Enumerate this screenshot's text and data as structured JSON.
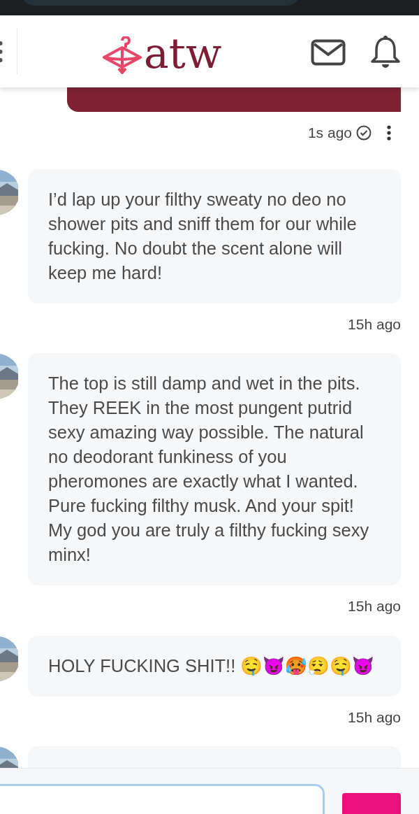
{
  "header": {
    "logo_text": "atw"
  },
  "sent_message": {
    "time": "1s ago",
    "read": true
  },
  "messages": [
    {
      "text": "I’d lap up your filthy sweaty no deo no shower pits and sniff them for our while fucking. No doubt the scent alone will keep me hard!",
      "time": "15h ago"
    },
    {
      "text": "The top is still damp and wet in the pits. They REEK in the most pungent putrid sexy amazing way possible. The natural no deodorant funkiness of you pheromones are exactly what I wanted. Pure fucking filthy musk. And your spit! My god you are truly a filthy fucking sexy minx!",
      "time": "15h ago"
    },
    {
      "text": "HOLY FUCKING SHIT!! 🤤😈🥵😮‍💨🤤😈",
      "time": "15h ago"
    }
  ]
}
